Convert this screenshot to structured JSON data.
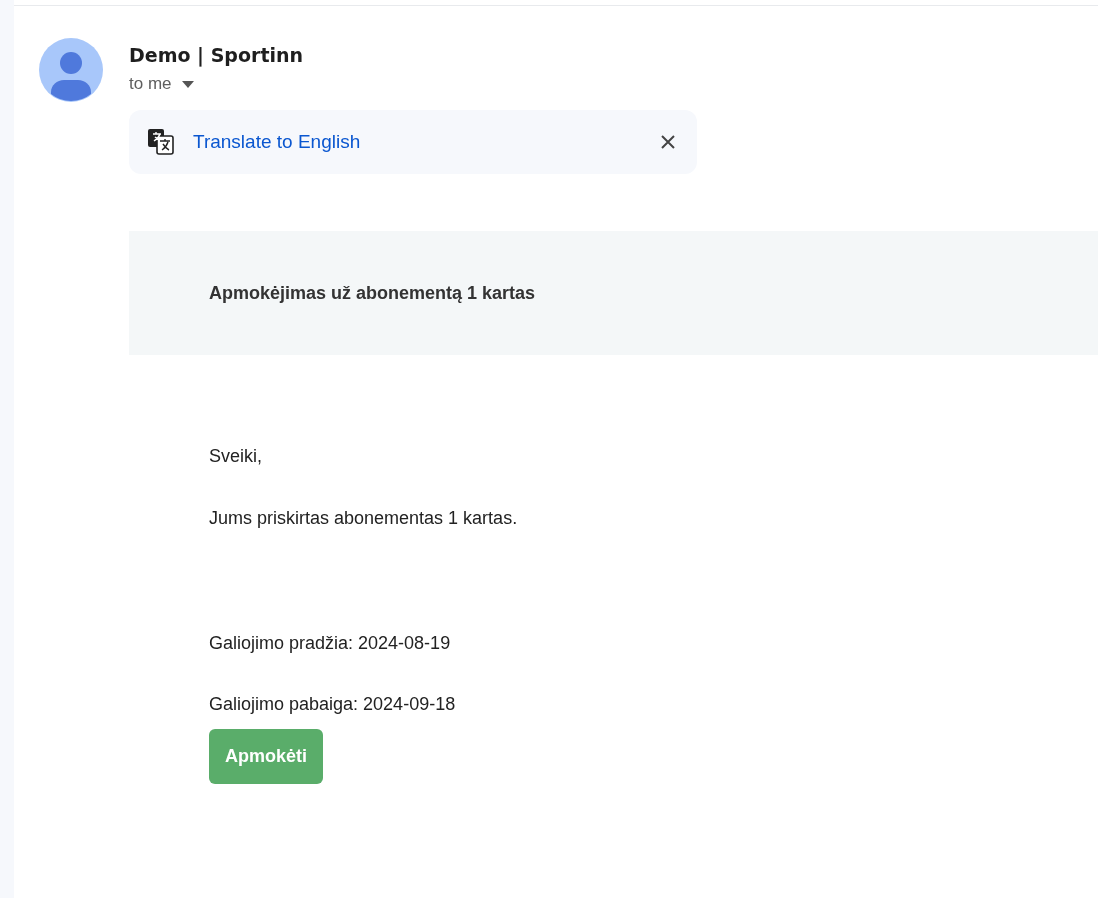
{
  "message": {
    "sender": "Demo | Sportinn",
    "recipient": "to me"
  },
  "translate_bar": {
    "label": "Translate to English"
  },
  "email": {
    "heading": "Apmokėjimas už abonementą 1 kartas",
    "greeting": "Sveiki,",
    "intro": "Jums priskirtas abonementas 1 kartas.",
    "details": [
      "Galiojimo pradžia: 2024-08-19",
      "Galiojimo pabaiga: 2024-09-18"
    ],
    "button": "Apmokėti"
  }
}
